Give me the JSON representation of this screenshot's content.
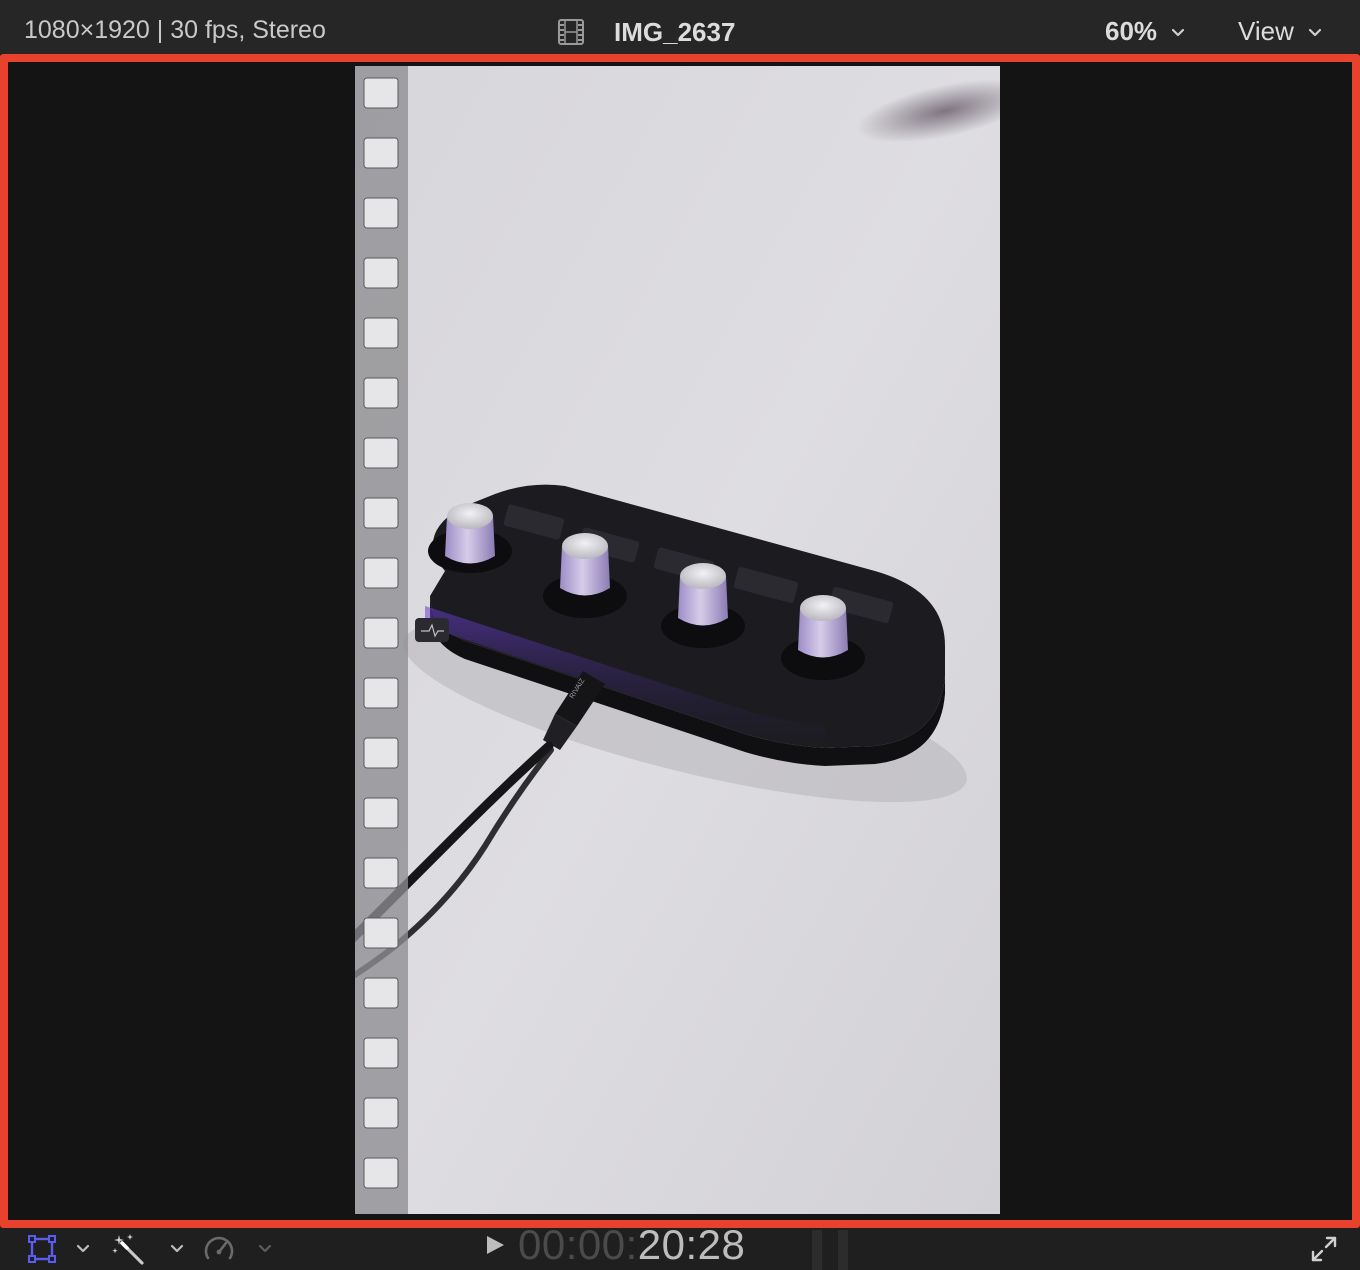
{
  "header": {
    "format_info": "1080×1920 | 30 fps, Stereo",
    "clip_icon": "film-strip-icon",
    "clip_name": "IMG_2637",
    "zoom_label": "60%",
    "view_label": "View"
  },
  "viewer": {
    "border_color": "#e8412c",
    "content": "video-frame-image"
  },
  "toolbar": {
    "transform_icon": "transform-crop-icon",
    "enhance_icon": "magic-wand-icon",
    "retime_icon": "speedometer-icon",
    "play_icon": "play-icon",
    "timecode_dim": "00:00:",
    "timecode_bright": "20:28",
    "fullscreen_icon": "expand-fullscreen-icon",
    "accent_color": "#5a5cf0"
  }
}
